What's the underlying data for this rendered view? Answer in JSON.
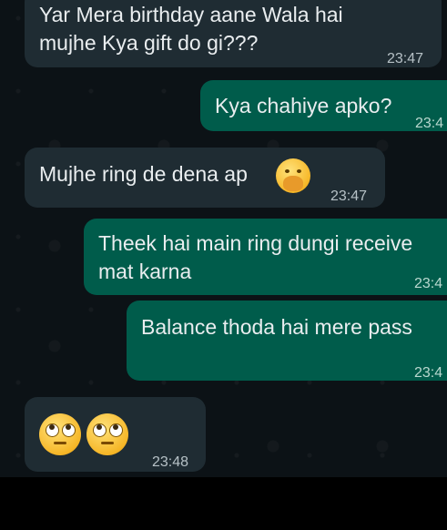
{
  "messages": [
    {
      "direction": "in",
      "lines": [
        "Yar Mera birthday aane Wala hai",
        "mujhe Kya gift do gi???"
      ],
      "time": "23:47"
    },
    {
      "direction": "out",
      "lines": [
        "Kya chahiye apko?"
      ],
      "time": "23:4"
    },
    {
      "direction": "in",
      "lines": [
        "Mujhe ring de dena ap"
      ],
      "time": "23:47",
      "emoji": "hand-over-mouth-emoji"
    },
    {
      "direction": "out",
      "lines": [
        "Theek hai main ring dungi receive",
        "mat karna"
      ],
      "time": "23:4"
    },
    {
      "direction": "out",
      "lines": [
        "Balance thoda hai mere pass"
      ],
      "time": "23:4"
    },
    {
      "direction": "in",
      "lines": [],
      "time": "23:48",
      "emoji": "rolling-eyes-emoji x2"
    }
  ],
  "colors": {
    "incoming": "#1f2c33",
    "outgoing": "#005c4b",
    "background": "#0c1216",
    "text": "#e9edef"
  }
}
